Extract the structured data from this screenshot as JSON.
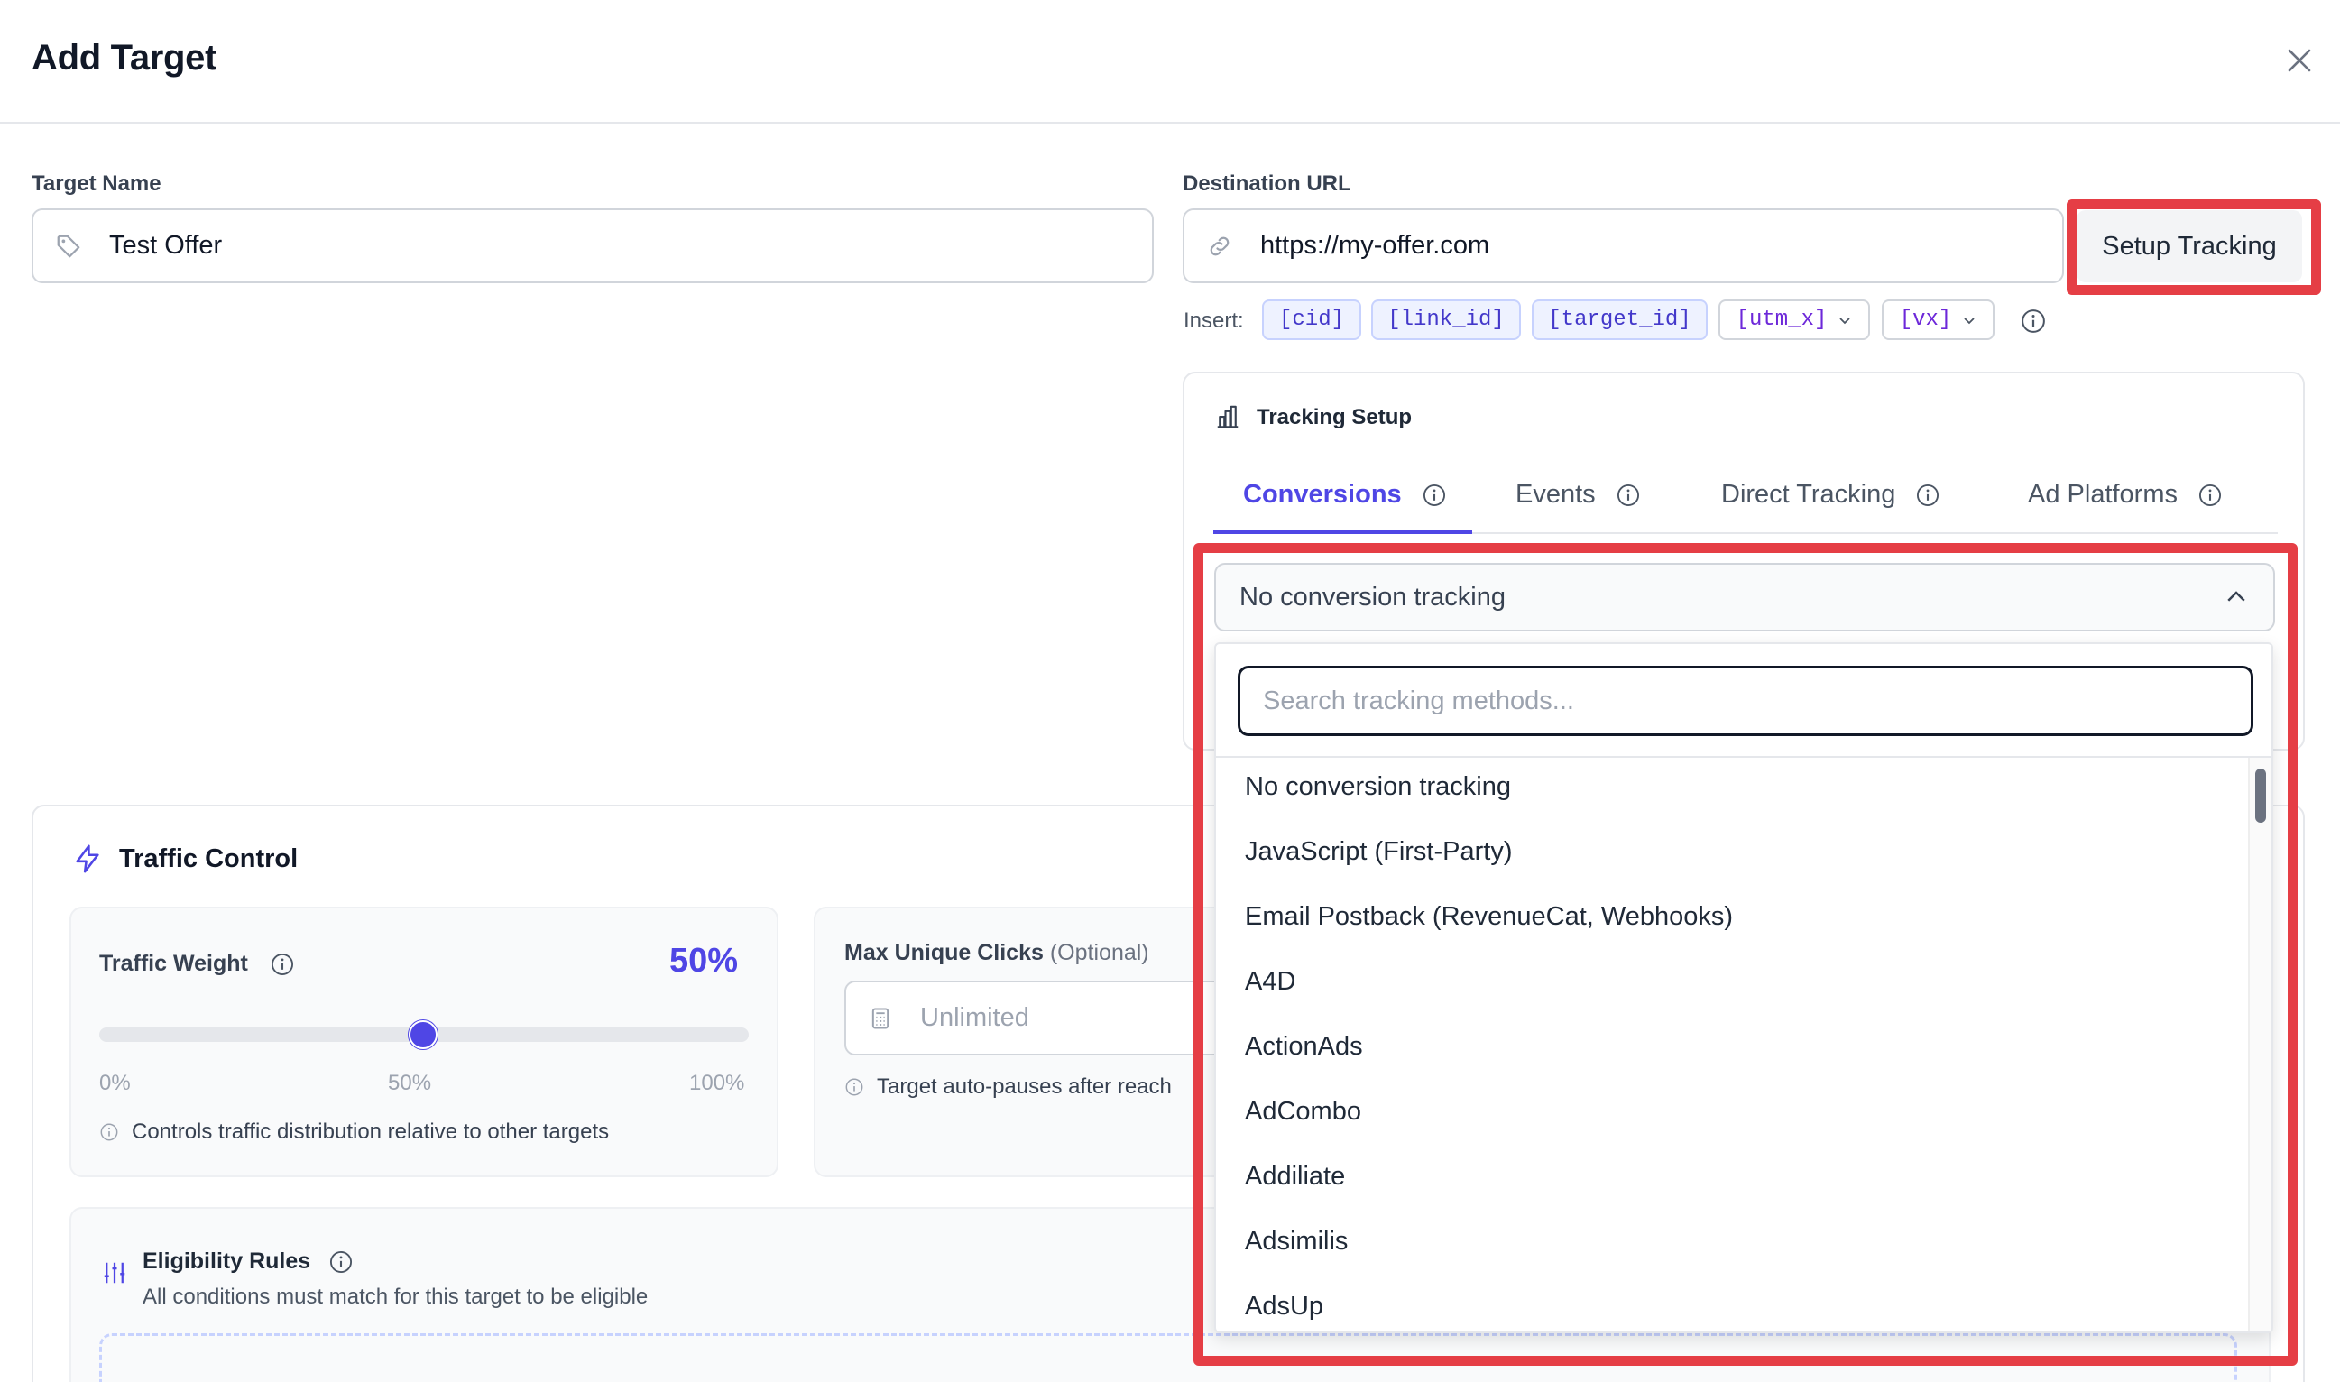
{
  "header": {
    "title": "Add Target"
  },
  "target_name": {
    "label": "Target Name",
    "value": "Test Offer"
  },
  "destination": {
    "label": "Destination URL",
    "value": "https://my-offer.com",
    "setup_button": "Setup Tracking"
  },
  "insert": {
    "label": "Insert:",
    "chips": [
      "[cid]",
      "[link_id]",
      "[target_id]"
    ],
    "dropdown_chips": [
      "[utm_x]",
      "[vx]"
    ]
  },
  "tracking_setup": {
    "title": "Tracking Setup",
    "tabs": [
      "Conversions",
      "Events",
      "Direct Tracking",
      "Ad Platforms"
    ],
    "active_tab": "Conversions",
    "selected": "No conversion tracking",
    "search_placeholder": "Search tracking methods...",
    "options": [
      "No conversion tracking",
      "JavaScript (First-Party)",
      "Email Postback (RevenueCat, Webhooks)",
      "A4D",
      "ActionAds",
      "AdCombo",
      "Addiliate",
      "Adsimilis",
      "AdsUp"
    ]
  },
  "traffic_control": {
    "title": "Traffic Control",
    "weight": {
      "label": "Traffic Weight",
      "value_text": "50%",
      "value": 50,
      "ticks": [
        "0%",
        "50%",
        "100%"
      ],
      "hint": "Controls traffic distribution relative to other targets"
    },
    "max_clicks": {
      "label": "Max Unique Clicks",
      "optional": "(Optional)",
      "placeholder": "Unlimited",
      "hint": "Target auto-pauses after reach"
    },
    "eligibility": {
      "title": "Eligibility Rules",
      "subtitle": "All conditions must match for this target to be eligible"
    }
  },
  "colors": {
    "accent": "#4f46e5",
    "highlight": "#e53e45"
  }
}
